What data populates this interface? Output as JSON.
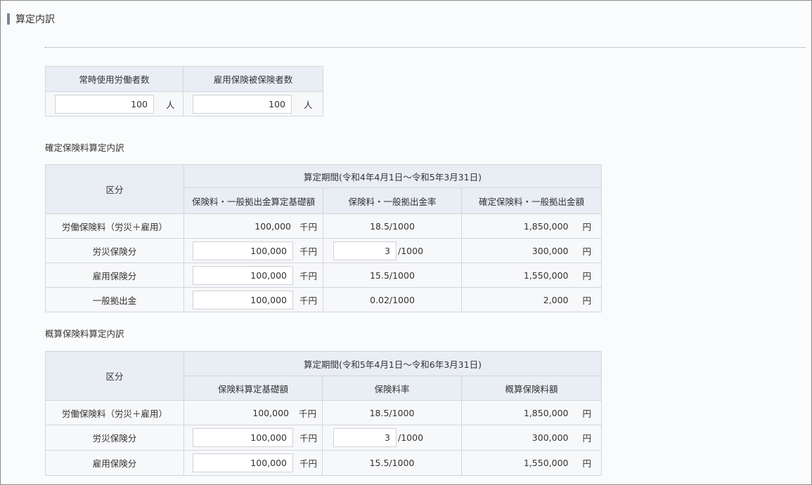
{
  "section_title": "算定内訳",
  "workers": {
    "col1_header": "常時使用労働者数",
    "col2_header": "雇用保険被保険者数",
    "col1_value": "100",
    "col2_value": "100",
    "unit": "人"
  },
  "confirmed": {
    "title": "確定保険料算定内訳",
    "kubun_header": "区分",
    "period_header": "算定期間(令和4年4月1日～令和5年3月31日)",
    "col_base": "保険料・一般拠出金算定基礎額",
    "col_rate": "保険料・一般拠出金率",
    "col_amount": "確定保険料・一般拠出金額",
    "rows": [
      {
        "label": "労働保険料（労災＋雇用）",
        "base": "100,000",
        "base_unit": "千円",
        "rate": "18.5/1000",
        "amount": "1,850,000",
        "amount_unit": "円"
      },
      {
        "label": "労災保険分",
        "base": "100,000",
        "base_unit": "千円",
        "rate_input": "3",
        "rate_suffix": "/1000",
        "amount": "300,000",
        "amount_unit": "円"
      },
      {
        "label": "雇用保険分",
        "base": "100,000",
        "base_unit": "千円",
        "rate": "15.5/1000",
        "amount": "1,550,000",
        "amount_unit": "円"
      },
      {
        "label": "一般拠出金",
        "base": "100,000",
        "base_unit": "千円",
        "rate": "0.02/1000",
        "amount": "2,000",
        "amount_unit": "円"
      }
    ]
  },
  "estimated": {
    "title": "概算保険料算定内訳",
    "kubun_header": "区分",
    "period_header": "算定期間(令和5年4月1日～令和6年3月31日)",
    "col_base": "保険料算定基礎額",
    "col_rate": "保険料率",
    "col_amount": "概算保険料額",
    "rows": [
      {
        "label": "労働保険料（労災＋雇用）",
        "base": "100,000",
        "base_unit": "千円",
        "rate": "18.5/1000",
        "amount": "1,850,000",
        "amount_unit": "円"
      },
      {
        "label": "労災保険分",
        "base": "100,000",
        "base_unit": "千円",
        "rate_input": "3",
        "rate_suffix": "/1000",
        "amount": "300,000",
        "amount_unit": "円"
      },
      {
        "label": "雇用保険分",
        "base": "100,000",
        "base_unit": "千円",
        "rate": "15.5/1000",
        "amount": "1,550,000",
        "amount_unit": "円"
      }
    ]
  }
}
